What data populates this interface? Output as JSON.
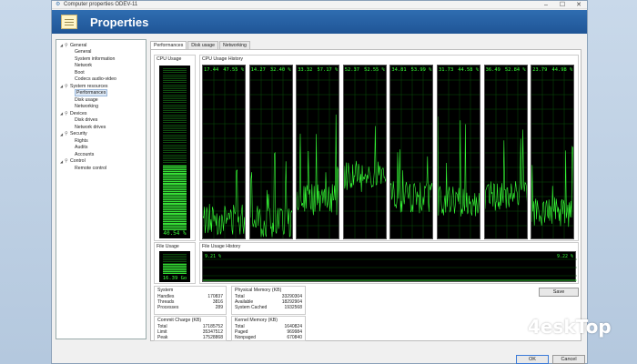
{
  "window": {
    "title": "Computer properties ODEV-11",
    "heading": "Properties",
    "controls": [
      "–",
      "☐",
      "✕"
    ]
  },
  "tree": [
    {
      "label": "General",
      "level": 0,
      "expanded": true
    },
    {
      "label": "General",
      "level": 1
    },
    {
      "label": "System information",
      "level": 1
    },
    {
      "label": "Network",
      "level": 1
    },
    {
      "label": "Boot",
      "level": 1
    },
    {
      "label": "Codecs audio-video",
      "level": 1
    },
    {
      "label": "System resources",
      "level": 0,
      "expanded": true
    },
    {
      "label": "Performances",
      "level": 1,
      "selected": true
    },
    {
      "label": "Disk usage",
      "level": 1
    },
    {
      "label": "Networking",
      "level": 1
    },
    {
      "label": "Devices",
      "level": 0,
      "expanded": true
    },
    {
      "label": "Disk drives",
      "level": 1
    },
    {
      "label": "Network drives",
      "level": 1
    },
    {
      "label": "Security",
      "level": 0,
      "expanded": true
    },
    {
      "label": "Rights",
      "level": 1
    },
    {
      "label": "Audits",
      "level": 1
    },
    {
      "label": "Accounts",
      "level": 1
    },
    {
      "label": "Control",
      "level": 0,
      "expanded": true
    },
    {
      "label": "Remote control",
      "level": 1
    }
  ],
  "tabs": [
    {
      "label": "Performances",
      "active": true
    },
    {
      "label": "Disk usage"
    },
    {
      "label": "Networking"
    }
  ],
  "cpu_usage": {
    "label": "CPU Usage",
    "value_text": "40.54 %",
    "fraction": 0.4
  },
  "cpu_history": {
    "label": "CPU Usage History",
    "cores": [
      {
        "a": "17.44",
        "b": "47.55 %"
      },
      {
        "a": "14.27",
        "b": "32.40 %"
      },
      {
        "a": "33.32",
        "b": "57.17 %"
      },
      {
        "a": "52.37",
        "b": "52.55 %"
      },
      {
        "a": "34.81",
        "b": "53.99 %"
      },
      {
        "a": "31.73",
        "b": "44.58 %"
      },
      {
        "a": "36.49",
        "b": "52.84 %"
      },
      {
        "a": "23.79",
        "b": "44.98 %"
      }
    ]
  },
  "file_usage": {
    "label": "File Usage",
    "value_text": "16.39 Go",
    "fraction": 0.5
  },
  "file_history": {
    "label": "File Usage History",
    "left": "9.21 %",
    "right": "9.22 %"
  },
  "system": {
    "title": "System",
    "rows": [
      {
        "k": "Handles",
        "v": "170837"
      },
      {
        "k": "Threads",
        "v": "3816"
      },
      {
        "k": "Processes",
        "v": "289"
      }
    ]
  },
  "physical": {
    "title": "Physical Memory (KB)",
    "rows": [
      {
        "k": "Total",
        "v": "33290304"
      },
      {
        "k": "Available",
        "v": "18292904"
      },
      {
        "k": "System Cached",
        "v": "1932568"
      }
    ]
  },
  "commit": {
    "title": "Commit Charge (KB)",
    "rows": [
      {
        "k": "Total",
        "v": "17185752"
      },
      {
        "k": "Limit",
        "v": "35347512"
      },
      {
        "k": "Peak",
        "v": "17528868"
      }
    ]
  },
  "kernel": {
    "title": "Kernel Memory (KB)",
    "rows": [
      {
        "k": "Total",
        "v": "1640824"
      },
      {
        "k": "Paged",
        "v": "969984"
      },
      {
        "k": "Nonpaged",
        "v": "670840"
      }
    ]
  },
  "buttons": {
    "save": "Save",
    "ok": "OK",
    "cancel": "Cancel"
  },
  "watermark": {
    "text": "4eskTop"
  },
  "colors": {
    "graph_green": "#37ff37",
    "banner": "#2f6db1"
  }
}
